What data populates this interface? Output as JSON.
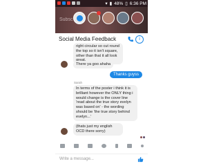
{
  "status_bar": {
    "battery": "48%",
    "time": "6:36 PM"
  },
  "background": {
    "partial_text": "Subsc"
  },
  "header": {
    "title": "Social Media Feedback"
  },
  "messages": [
    {
      "text": "right circular so cut round the top so it isn't square, other than that it all look great."
    },
    {
      "text": "There ya goo ahaha"
    },
    {
      "text": "Thanks guyss"
    },
    {
      "sender": "Sarah"
    },
    {
      "text": "In terms of the poster i think it is brilliant however the ONLY thing i would change is the cover line 'read about the true story evelyn was based on' - the wording should be 'the true story behind evelyn...'"
    },
    {
      "text": "(thats just my english OCD there sorry)"
    }
  ],
  "composer": {
    "placeholder": "Write a message..."
  },
  "colors": {
    "accent": "#1e88e5",
    "incoming_bubble": "#f0f0f0"
  }
}
